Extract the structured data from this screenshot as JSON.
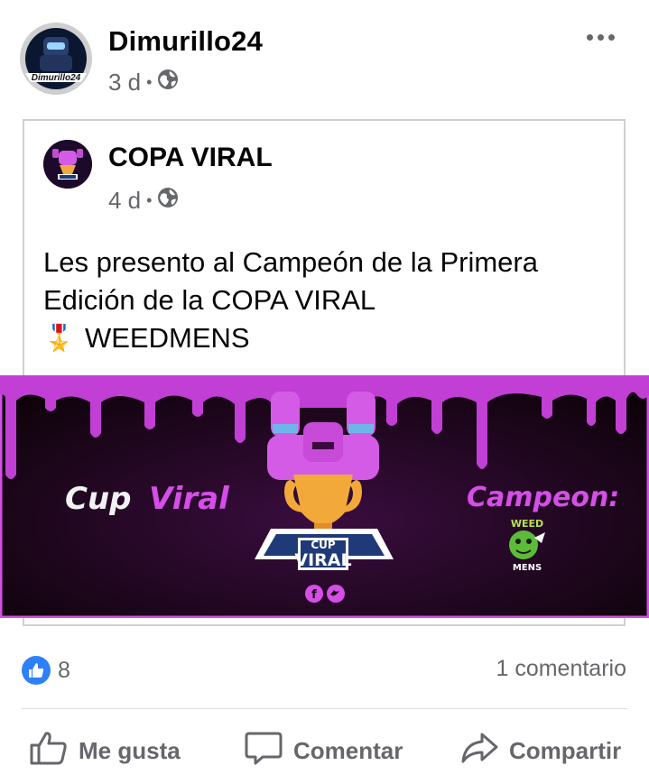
{
  "post": {
    "author": "Dimurillo24",
    "avatar_text": "Dimurillo24",
    "time": "3 d",
    "separator": "•",
    "privacy_icon": "globe-icon"
  },
  "shared": {
    "page_name": "COPA VIRAL",
    "time": "4 d",
    "separator": "•",
    "privacy_icon": "globe-icon",
    "text_line1": "Les presento al Campeón de la Primera",
    "text_line2": "Edición de la COPA VIRAL",
    "medal_emoji": "🎖️",
    "text_line3": "WEEDMENS"
  },
  "banner": {
    "left_text_1": "Cup",
    "left_text_2": "Viral",
    "logo_top": "CUP",
    "logo_bottom": "VIRAL",
    "right_text": "Campeon:",
    "winner_top": "WEED",
    "winner_bottom": "MENS",
    "colors": {
      "bg": "#12030f",
      "drip": "#c23fd6",
      "accent": "#d54ee8",
      "trophy": "#f3a83a"
    }
  },
  "stats": {
    "likes": "8",
    "comments": "1 comentario"
  },
  "actions": {
    "like": "Me gusta",
    "comment": "Comentar",
    "share": "Compartir"
  },
  "colors": {
    "like_blue": "#2e80f7",
    "secondary_text": "#65676b",
    "divider": "#dadde1"
  }
}
